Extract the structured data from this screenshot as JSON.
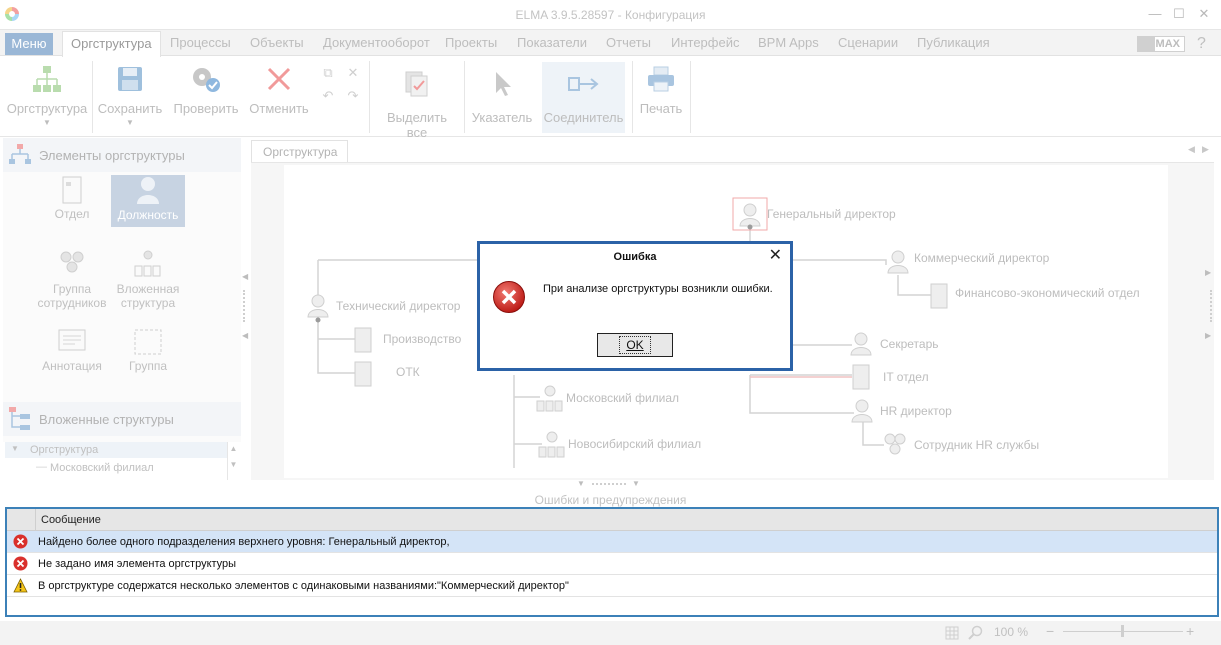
{
  "window": {
    "title": "ELMA 3.9.5.28597 - Конфигурация",
    "controls": [
      "—",
      "☐",
      "✕"
    ]
  },
  "ribbon_tabs": {
    "menu": "Меню",
    "tabs": [
      "Оргструктура",
      "Процессы",
      "Объекты",
      "Документооборот",
      "Проекты",
      "Показатели",
      "Отчеты",
      "Интерфейс",
      "BPM Apps",
      "Сценарии",
      "Публикация"
    ],
    "max_label": "MAX",
    "help": "?"
  },
  "ribbon": {
    "orgstructure": "Оргструктура",
    "save": "Сохранить",
    "check": "Проверить",
    "cancel": "Отменить",
    "select_all": "Выделить все",
    "pointer": "Указатель",
    "connector": "Соединитель",
    "print": "Печать"
  },
  "left_panel": {
    "elements_header": "Элементы оргструктуры",
    "items": [
      "Отдел",
      "Должность",
      "Группа сотрудников",
      "Вложенная структура",
      "Аннотация",
      "Группа"
    ],
    "nested_header": "Вложенные структуры",
    "tree": [
      "Оргструктура",
      "Московский филиал"
    ]
  },
  "doc_tab": "Оргструктура",
  "org_chart": {
    "nodes": [
      "Генеральный директор",
      "Коммерческий директор",
      "Финансово-экономический отдел",
      "Технический директор",
      "Производство",
      "ОТК",
      "Секретарь",
      "IT отдел",
      "HR директор",
      "Сотрудник HR службы",
      "Московский филиал",
      "Новосибирский филиал"
    ]
  },
  "errors_panel": {
    "caption": "Ошибки и предупреждения",
    "column": "Сообщение",
    "rows": [
      {
        "type": "error",
        "text": "Найдено более одного подразделения верхнего уровня: Генеральный директор,"
      },
      {
        "type": "error",
        "text": "Не задано имя элемента оргструктуры"
      },
      {
        "type": "warning",
        "text": "В оргструктуре содержатся несколько элементов с одинаковыми названиями:\"Коммерческий директор\""
      }
    ]
  },
  "status": {
    "zoom": "100 %"
  },
  "dialog": {
    "title": "Ошибка",
    "message": "При анализе оргструктуры возникли ошибки.",
    "ok": "OK"
  },
  "colors": {
    "accent": "#3c81b8",
    "dialog_border": "#2b62a7",
    "error": "#d9302c",
    "warning": "#f5c518"
  }
}
